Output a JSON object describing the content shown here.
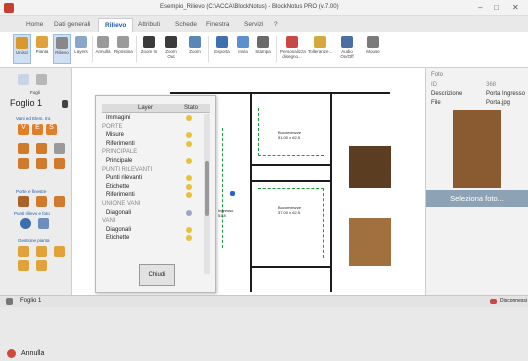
{
  "window": {
    "title": "Esempio_Rilievo (C:\\ACCA\\BlockNotus) - BlockNotus PRO (v.7.00)",
    "controls": [
      "–",
      "□",
      "✕"
    ]
  },
  "tabs": [
    "Home",
    "Dati generali",
    "Rilievo",
    "Attributi",
    "Schede",
    "Finestra",
    "Servizi",
    "?"
  ],
  "ribbon_buttons": [
    "Unisci",
    "Pianta",
    "Rilievo",
    "Layers",
    "Annulla",
    "Ripristina",
    "Zoom In",
    "Zoom Out",
    "Zoom",
    "Esporta",
    "Invia",
    "Stampa",
    "Personalizza disegno...",
    "Tolleranze...",
    "Audio On/Off",
    "Mouse"
  ],
  "left": {
    "fogli_label": "Fogli",
    "foglio": "Foglio 1",
    "vani_label": "Vani ed Elem. Int.",
    "ve_btns": [
      "V",
      "E",
      "S"
    ],
    "porte_label": "Porte e finestre",
    "punti_label": "Punti rilievo e foto",
    "gestione_label": "Gestione pianta",
    "annulla": "Annulla"
  },
  "canvas": {
    "rooms": [
      {
        "name": "Bucomenzze",
        "dims": "51.00 x 62.5"
      },
      {
        "name": "Ingresso",
        "dims": "51.8"
      },
      {
        "name": "Bucomenzze",
        "dims": "37.00 x 62.5"
      }
    ]
  },
  "layers": {
    "col_layer": "Layer",
    "col_stato": "Stato",
    "rows": [
      {
        "n": "Immagini",
        "g": false,
        "c": "#e8c23a"
      },
      {
        "n": "PORTE",
        "g": true,
        "c": ""
      },
      {
        "n": "Misure",
        "g": false,
        "c": "#e8c23a"
      },
      {
        "n": "Riferimenti",
        "g": false,
        "c": "#e8c23a"
      },
      {
        "n": "PRINCIPALE",
        "g": true,
        "c": ""
      },
      {
        "n": "Principale",
        "g": false,
        "c": "#e8c23a"
      },
      {
        "n": "PUNTI RILEVANTI",
        "g": true,
        "c": ""
      },
      {
        "n": "Punti rilevanti",
        "g": false,
        "c": "#e8c23a"
      },
      {
        "n": "Etichette",
        "g": false,
        "c": "#e8c23a"
      },
      {
        "n": "Riferimenti",
        "g": false,
        "c": "#e8c23a"
      },
      {
        "n": "UNIONE VANI",
        "g": true,
        "c": ""
      },
      {
        "n": "Diagonali",
        "g": false,
        "c": "#9aa7c8"
      },
      {
        "n": "VANI",
        "g": true,
        "c": ""
      },
      {
        "n": "Diagonali",
        "g": false,
        "c": "#e8c23a"
      },
      {
        "n": "Etichette",
        "g": false,
        "c": "#e8c23a"
      }
    ],
    "close": "Chiudi"
  },
  "right": {
    "section": "Foto",
    "rows": [
      {
        "k": "ID",
        "v": "368"
      },
      {
        "k": "Descrizione",
        "v": "Porta Ingresso"
      },
      {
        "k": "File",
        "v": "Porta.jpg"
      }
    ],
    "select": "Seleziona foto..."
  },
  "status": {
    "left": "Foglio 1",
    "right": "Disconnessi"
  }
}
